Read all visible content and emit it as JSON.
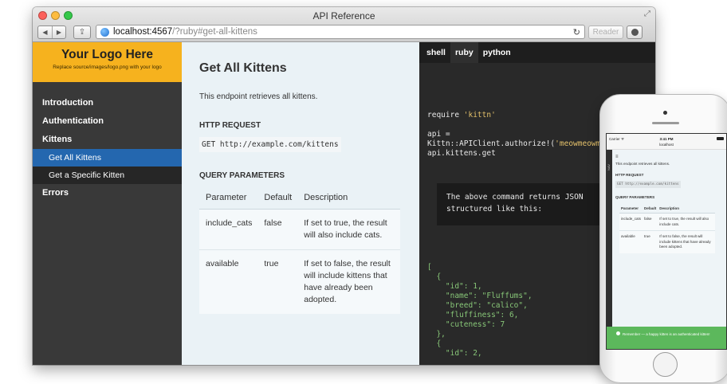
{
  "window": {
    "title": "API Reference",
    "url_host": "localhost:4567",
    "url_path": "/?ruby#get-all-kittens",
    "reader_label": "Reader"
  },
  "logo": {
    "title": "Your Logo Here",
    "subtitle": "Replace source/images/logo.png with your logo"
  },
  "nav": {
    "introduction": "Introduction",
    "authentication": "Authentication",
    "kittens": "Kittens",
    "get_all_kittens": "Get All Kittens",
    "get_specific_kitten": "Get a Specific Kitten",
    "errors": "Errors"
  },
  "content": {
    "title": "Get All Kittens",
    "intro": "This endpoint retrieves all kittens.",
    "http_heading": "HTTP Request",
    "http_code": "GET http://example.com/kittens",
    "query_heading": "Query Parameters",
    "table_headers": [
      "Parameter",
      "Default",
      "Description"
    ],
    "rows": [
      {
        "parameter": "include_cats",
        "default": "false",
        "description": "If set to true, the result will also include cats."
      },
      {
        "parameter": "available",
        "default": "true",
        "description": "If set to false, the result will include kittens that have already been adopted."
      }
    ]
  },
  "code": {
    "tabs": [
      "shell",
      "ruby",
      "python"
    ],
    "active_tab": "ruby",
    "line_require": "require ",
    "line_require_str": "'kittn'",
    "line_api": "api =",
    "line_client": "Kittn::APIClient.authorize!(",
    "line_client_str": "'meowmeowmeow'",
    "line_get": "api.kittens.get",
    "callout": "The above command returns JSON\nstructured like this:",
    "json_text": "[\n  {\n    \"id\": 1,\n    \"name\": \"Fluffums\",\n    \"breed\": \"calico\",\n    \"fluffiness\": 6,\n    \"cuteness\": 7\n  },\n  {\n    \"id\": 2,"
  },
  "phone": {
    "carrier": "Carrier ᯤ",
    "time": "3:41 PM",
    "host": "localhost",
    "nav_label": "NAV",
    "intro": "This endpoint retrieves all kittens.",
    "http_heading": "HTTP REQUEST",
    "http_code": "GET http://example.com/kittens",
    "query_heading": "QUERY PARAMETERS",
    "table_headers": [
      "Parameter",
      "Default",
      "Description"
    ],
    "rows": [
      {
        "parameter": "include_cats",
        "default": "false",
        "description": "If set to true, the result will also include cats."
      },
      {
        "parameter": "available",
        "default": "true",
        "description": "If set to false, the result will include kittens that have already been adopted."
      }
    ],
    "notice": "Remember — a happy kitten is an authenticated kitten!"
  },
  "colors": {
    "logo_bg": "#f6b21e",
    "sidebar_bg": "#393939",
    "active_nav": "#2467af",
    "content_bg": "#eaf2f6",
    "code_bg": "#292929",
    "string_color": "#e3c06a",
    "json_color": "#88c778",
    "notice_green": "#5cb85c"
  }
}
